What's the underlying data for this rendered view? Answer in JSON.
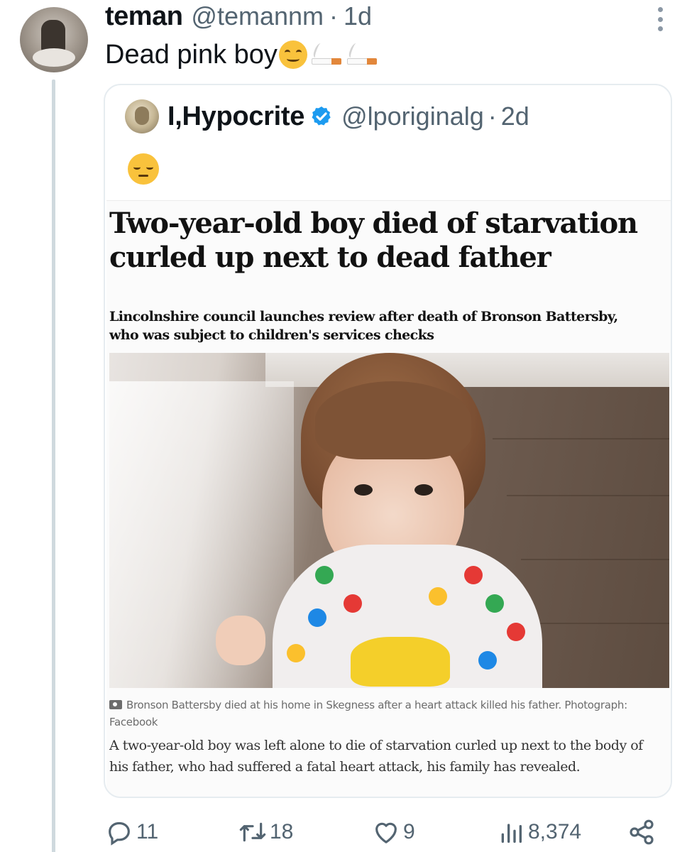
{
  "tweet": {
    "author_name": "teman",
    "author_handle": "@temannm",
    "separator": "·",
    "timestamp": "1d",
    "text": "Dead pink boy",
    "emojis": [
      "smiling-face-emoji",
      "cigarette-emoji",
      "cigarette-emoji"
    ]
  },
  "quote": {
    "author_name": "I,Hypocrite",
    "verified": true,
    "author_handle": "@lporiginalg",
    "separator": "·",
    "timestamp": "2d",
    "emoji": "pensive-face-emoji",
    "article": {
      "headline": "Two-year-old boy died of starvation curled up next to dead father",
      "standfirst": "Lincolnshire council launches review after death of Bronson Battersby, who was subject to children's services checks",
      "caption": "Bronson Battersby died at his home in Skegness after a heart attack killed his father. Photograph: Facebook",
      "body": "A two-year-old boy was left alone to die of starvation curled up next to the body of his father, who had suffered a fatal heart attack, his family has revealed."
    }
  },
  "actions": {
    "replies": "11",
    "retweets": "18",
    "likes": "9",
    "views": "8,374"
  },
  "colors": {
    "text": "#0f1419",
    "secondary": "#536471",
    "verified": "#1d9bf0",
    "border": "#e6ecf0"
  }
}
